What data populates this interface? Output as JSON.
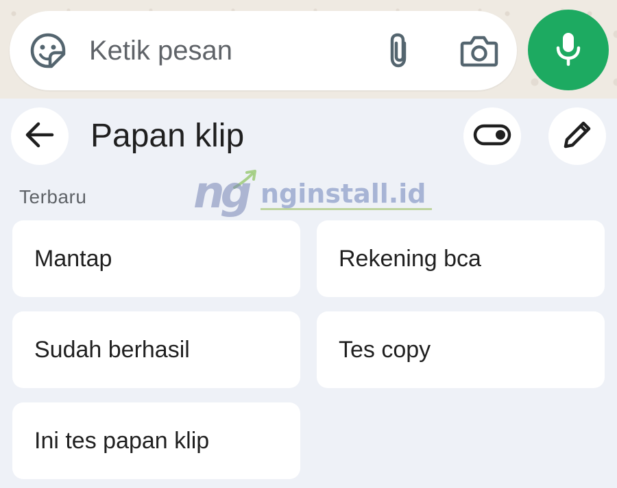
{
  "compose": {
    "placeholder": "Ketik pesan",
    "icons": [
      "sticker-icon",
      "attach-icon",
      "camera-icon",
      "mic-icon"
    ],
    "mic_color": "#1daa61"
  },
  "clipboard": {
    "title": "Papan klip",
    "section_label": "Terbaru",
    "header_icons": [
      "back-arrow-icon",
      "toggle-icon",
      "pencil-icon"
    ],
    "clips": [
      {
        "text": "Mantap"
      },
      {
        "text": "Rekening bca"
      },
      {
        "text": "Sudah berhasil"
      },
      {
        "text": "Tes copy"
      },
      {
        "text": "Ini tes papan klip"
      }
    ]
  },
  "watermark": {
    "logo": "ng",
    "text": "nginstall.id"
  }
}
